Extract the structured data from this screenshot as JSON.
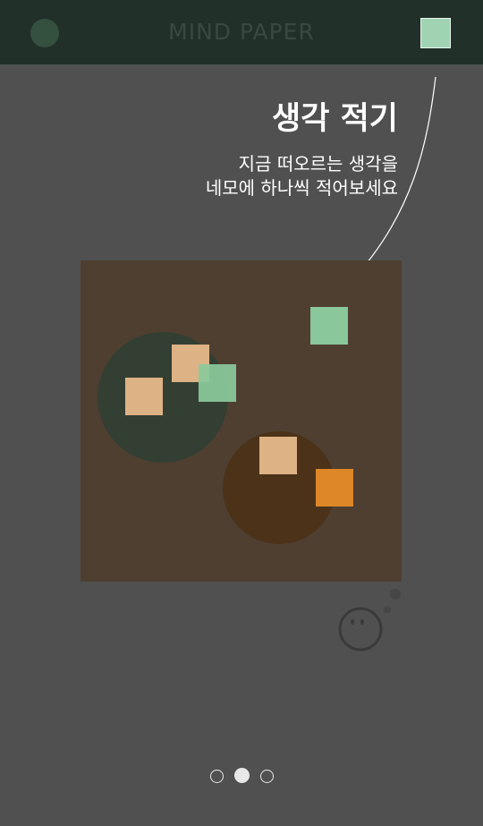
{
  "header": {
    "app_title": "MIND PAPER",
    "menu_icon": "circle-icon",
    "add_icon": "square-note-icon"
  },
  "intro": {
    "title": "생각 적기",
    "description_line1": "지금 떠오르는 생각을",
    "description_line2": "네모에 하나씩 적어보세요"
  },
  "board": {
    "notes": [
      {
        "id": "note-mint-top",
        "color": "#8ac79b"
      },
      {
        "id": "note-peach-1",
        "color": "#ddb285"
      },
      {
        "id": "note-peach-2",
        "color": "#ddb285"
      },
      {
        "id": "note-mint-2",
        "color": "#8bc99c"
      },
      {
        "id": "note-peach-3",
        "color": "#ddb285"
      },
      {
        "id": "note-orange",
        "color": "#dd8728"
      }
    ],
    "groups": [
      {
        "id": "group-green",
        "color": "#343f33"
      },
      {
        "id": "group-brown",
        "color": "#4b3219"
      }
    ]
  },
  "mascot_icon": "thinking-face-icon",
  "pager": {
    "pages": 3,
    "active_index": 1
  },
  "colors": {
    "background": "#505050",
    "header": "#22302a",
    "board": "#4e3f31",
    "accent_mint": "#9fd3b1"
  }
}
